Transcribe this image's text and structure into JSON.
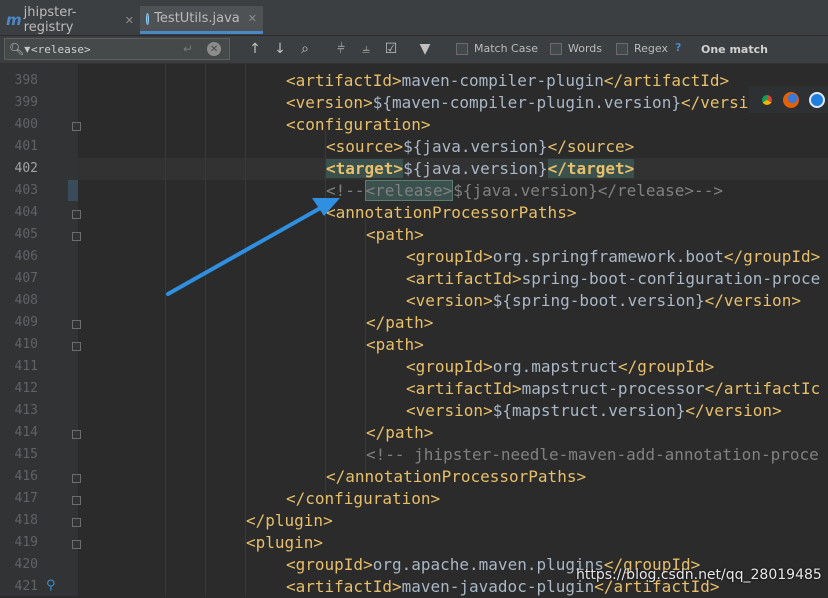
{
  "tabs": [
    {
      "icon": "maven-module-icon",
      "label": "jhipster-registry"
    },
    {
      "icon": "java-class-icon",
      "label": "TestUtils.java"
    }
  ],
  "search": {
    "value": "<release>",
    "options": {
      "match_case": "Match Case",
      "words": "Words",
      "regex": "Regex",
      "help": "?"
    },
    "result": "One match"
  },
  "code": {
    "line_numbers": [
      "398",
      "399",
      "400",
      "401",
      "402",
      "403",
      "404",
      "405",
      "406",
      "407",
      "408",
      "409",
      "410",
      "411",
      "412",
      "413",
      "414",
      "415",
      "416",
      "417",
      "418",
      "419",
      "420",
      "421"
    ],
    "current_line": "402",
    "lines": {
      "l398_tag_open": "<artifactId>",
      "l398_text": "maven-compiler-plugin",
      "l398_tag_close": "</artifactId>",
      "l399_tag_open": "<version>",
      "l399_text": "${maven-compiler-plugin.version}",
      "l399_tag_close": "</version>",
      "l400_tag": "<configuration>",
      "l401_tag_open": "<source>",
      "l401_text": "${java.version}",
      "l401_tag_close": "</source>",
      "l402_tag_open": "<target>",
      "l402_text": "${java.version}",
      "l402_tag_close": "</target>",
      "l403_cmt_start": "<!--",
      "l403_match": "<release>",
      "l403_cmt_rest": "${java.version}</release>-->",
      "l404_tag": "<annotationProcessorPaths>",
      "l405_tag": "<path>",
      "l406_tag_open": "<groupId>",
      "l406_text": "org.springframework.boot",
      "l406_tag_close": "</groupId>",
      "l407_tag_open": "<artifactId>",
      "l407_text": "spring-boot-configuration-proce",
      "l408_tag_open": "<version>",
      "l408_text": "${spring-boot.version}",
      "l408_tag_close": "</version>",
      "l409_tag": "</path>",
      "l410_tag": "<path>",
      "l411_tag_open": "<groupId>",
      "l411_text": "org.mapstruct",
      "l411_tag_close": "</groupId>",
      "l412_tag_open": "<artifactId>",
      "l412_text": "mapstruct-processor",
      "l412_tag_close": "</artifactIc",
      "l413_tag_open": "<version>",
      "l413_text": "${mapstruct.version}",
      "l413_tag_close": "</version>",
      "l414_tag": "</path>",
      "l415_cmt": "<!-- jhipster-needle-maven-add-annotation-proce",
      "l416_tag": "</annotationProcessorPaths>",
      "l417_tag": "</configuration>",
      "l418_tag": "</plugin>",
      "l419_tag": "<plugin>",
      "l420_tag_open": "<groupId>",
      "l420_text": "org.apache.maven.plugins",
      "l420_tag_close": "</groupId>",
      "l421_tag_open": "<artifactId>",
      "l421_text": "maven-javadoc-plugin",
      "l421_tag_close": "</artifactId>"
    }
  },
  "annotation": {
    "arrow_color": "#2f8fe0"
  },
  "browser_icons": [
    "chrome-icon",
    "firefox-icon",
    "safari-icon"
  ],
  "watermark": "https://blog.csdn.net/qq_28019485"
}
